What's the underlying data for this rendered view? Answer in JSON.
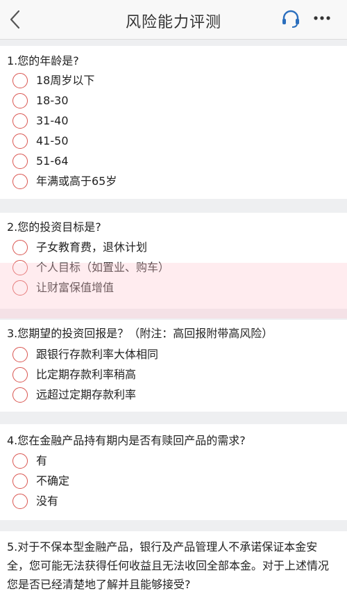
{
  "header": {
    "title": "风险能力评测"
  },
  "questions": [
    {
      "text": "1.您的年龄是?",
      "options": [
        "18周岁以下",
        "18-30",
        "31-40",
        "41-50",
        "51-64",
        "年满或高于65岁"
      ]
    },
    {
      "text": "2.您的投资目标是?",
      "options": [
        "子女教育费，退休计划",
        "个人目标（如置业、购车）",
        "让财富保值增值"
      ]
    },
    {
      "text": "3.您期望的投资回报是？（附注：高回报附带高风险）",
      "options": [
        "跟银行存款利率大体相同",
        "比定期存款利率稍高",
        "远超过定期存款利率"
      ]
    },
    {
      "text": "4.您在金融产品持有期内是否有赎回产品的需求?",
      "options": [
        "有",
        "不确定",
        "没有"
      ]
    },
    {
      "text": "5.对于不保本型金融产品，银行及产品管理人不承诺保证本金安全，您可能无法获得任何收益且无法收回全部本金。对于上述情况您是否已经清楚地了解并且能够接受?",
      "options": []
    }
  ],
  "colors": {
    "radio_border": "#d9544f",
    "background": "#eeeff1"
  },
  "icons": {
    "back": "chevron-left-icon",
    "service": "headset-icon",
    "more": "more-icon"
  }
}
